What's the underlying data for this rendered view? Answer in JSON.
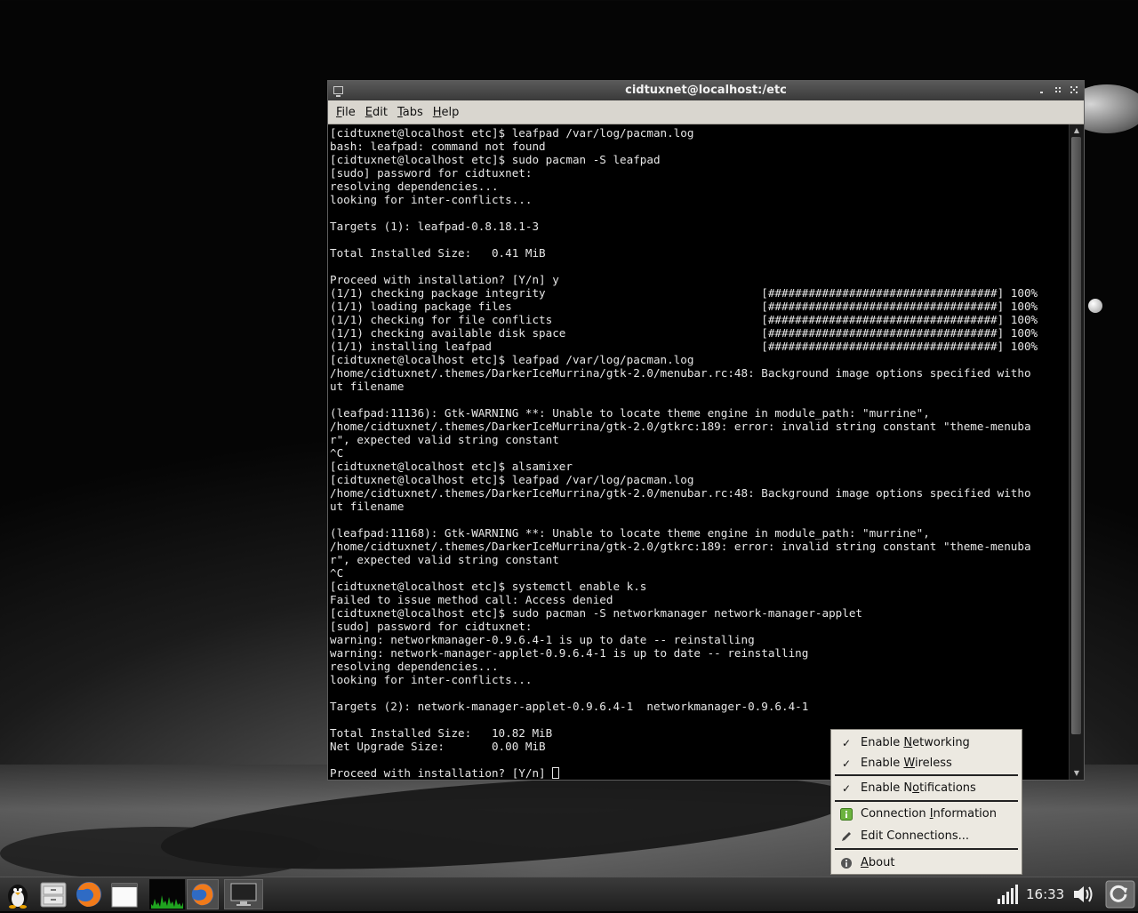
{
  "terminal": {
    "title": "cidtuxnet@localhost:/etc",
    "menu": {
      "file": {
        "ul": "F",
        "rest": "ile"
      },
      "edit": {
        "ul": "E",
        "rest": "dit"
      },
      "tabs": {
        "ul": "T",
        "rest": "abs"
      },
      "help": {
        "ul": "H",
        "rest": "elp"
      }
    },
    "lines": [
      "[cidtuxnet@localhost etc]$ leafpad /var/log/pacman.log",
      "bash: leafpad: command not found",
      "[cidtuxnet@localhost etc]$ sudo pacman -S leafpad",
      "[sudo] password for cidtuxnet:",
      "resolving dependencies...",
      "looking for inter-conflicts...",
      "",
      "Targets (1): leafpad-0.8.18.1-3",
      "",
      "Total Installed Size:   0.41 MiB",
      "",
      "Proceed with installation? [Y/n] y",
      "(1/1) checking package integrity                                [##################################] 100%",
      "(1/1) loading package files                                     [##################################] 100%",
      "(1/1) checking for file conflicts                               [##################################] 100%",
      "(1/1) checking available disk space                             [##################################] 100%",
      "(1/1) installing leafpad                                        [##################################] 100%",
      "[cidtuxnet@localhost etc]$ leafpad /var/log/pacman.log",
      "/home/cidtuxnet/.themes/DarkerIceMurrina/gtk-2.0/menubar.rc:48: Background image options specified witho",
      "ut filename",
      "",
      "(leafpad:11136): Gtk-WARNING **: Unable to locate theme engine in module_path: \"murrine\",",
      "/home/cidtuxnet/.themes/DarkerIceMurrina/gtk-2.0/gtkrc:189: error: invalid string constant \"theme-menuba",
      "r\", expected valid string constant",
      "^C",
      "[cidtuxnet@localhost etc]$ alsamixer",
      "[cidtuxnet@localhost etc]$ leafpad /var/log/pacman.log",
      "/home/cidtuxnet/.themes/DarkerIceMurrina/gtk-2.0/menubar.rc:48: Background image options specified witho",
      "ut filename",
      "",
      "(leafpad:11168): Gtk-WARNING **: Unable to locate theme engine in module_path: \"murrine\",",
      "/home/cidtuxnet/.themes/DarkerIceMurrina/gtk-2.0/gtkrc:189: error: invalid string constant \"theme-menuba",
      "r\", expected valid string constant",
      "^C",
      "[cidtuxnet@localhost etc]$ systemctl enable k.s",
      "Failed to issue method call: Access denied",
      "[cidtuxnet@localhost etc]$ sudo pacman -S networkmanager network-manager-applet",
      "[sudo] password for cidtuxnet:",
      "warning: networkmanager-0.9.6.4-1 is up to date -- reinstalling",
      "warning: network-manager-applet-0.9.6.4-1 is up to date -- reinstalling",
      "resolving dependencies...",
      "looking for inter-conflicts...",
      "",
      "Targets (2): network-manager-applet-0.9.6.4-1  networkmanager-0.9.6.4-1",
      "",
      "Total Installed Size:   10.82 MiB",
      "Net Upgrade Size:       0.00 MiB",
      ""
    ],
    "prompt_line": "Proceed with installation? [Y/n] "
  },
  "context_menu": {
    "enable_networking": {
      "pre": "Enable ",
      "ul": "N",
      "post": "etworking"
    },
    "enable_wireless": {
      "pre": "Enable ",
      "ul": "W",
      "post": "ireless"
    },
    "enable_notifications": {
      "pre": "Enable N",
      "ul": "o",
      "post": "tifications"
    },
    "connection_information": {
      "pre": "Connection ",
      "ul": "I",
      "post": "nformation"
    },
    "edit_connections": {
      "pre": "Edit Connections...",
      "ul": "",
      "post": ""
    },
    "about": {
      "pre": "",
      "ul": "A",
      "post": "bout"
    },
    "check_glyph": "✓"
  },
  "taskbar": {
    "clock": "16:33"
  },
  "colors": {
    "menu_bg": "#ece9e1",
    "terminal_bg": "#000000",
    "terminal_fg": "#e6e6e6",
    "taskbar_bg": "#2a2a2a"
  }
}
